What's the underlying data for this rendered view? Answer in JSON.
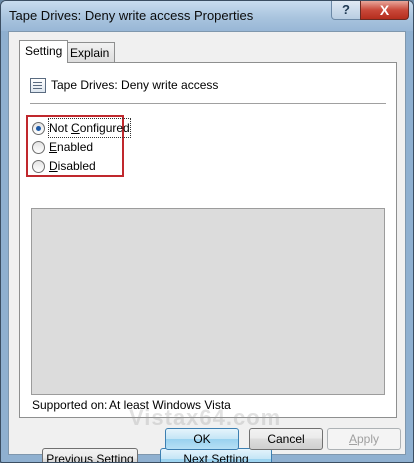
{
  "window": {
    "title": "Tape Drives: Deny write access Properties",
    "help_label": "?",
    "close_label": "X"
  },
  "tabs": [
    {
      "label": "Setting",
      "active": true
    },
    {
      "label": "Explain",
      "active": false
    }
  ],
  "policy": {
    "icon": "policy-icon",
    "name": "Tape Drives: Deny write access"
  },
  "options": [
    {
      "label": "Not Configured",
      "accel": "C",
      "checked": true
    },
    {
      "label": "Enabled",
      "accel": "E",
      "checked": false
    },
    {
      "label": "Disabled",
      "accel": "D",
      "checked": false
    }
  ],
  "supported": {
    "label": "Supported on:",
    "value": "At least Windows Vista"
  },
  "buttons": {
    "previous": "Previous Setting",
    "next": "Next Setting",
    "ok": "OK",
    "cancel": "Cancel",
    "apply": "Apply"
  },
  "watermark": "Vistax64.com"
}
